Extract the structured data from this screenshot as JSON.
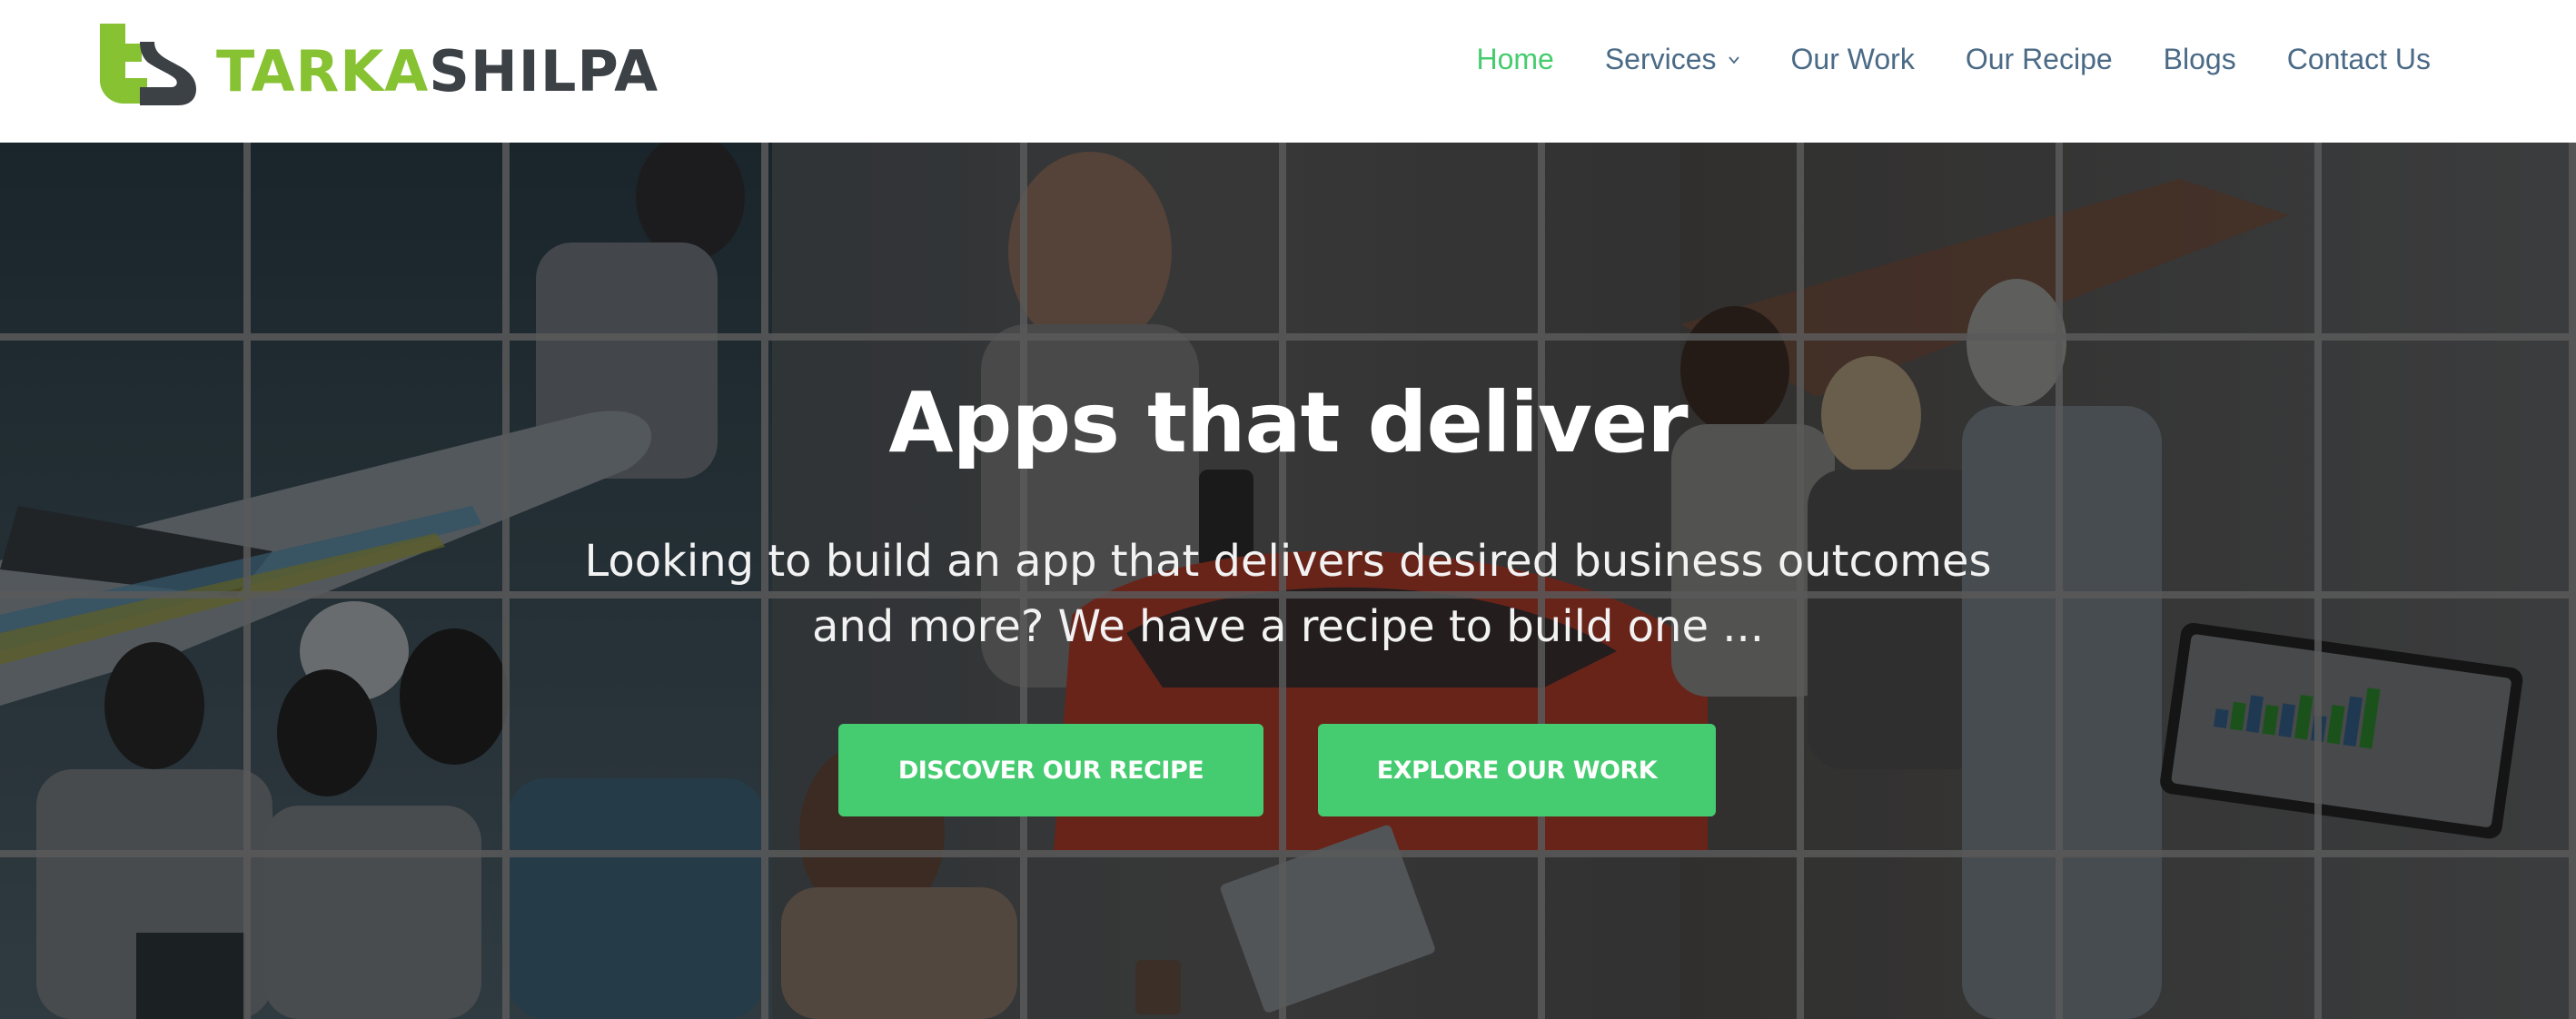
{
  "brand": {
    "logo_part1": "TARKA",
    "logo_part2": "SHILPA",
    "colors": {
      "green": "#86c232",
      "dark": "#3c4146"
    }
  },
  "nav": {
    "items": [
      {
        "label": "Home",
        "active": true
      },
      {
        "label": "Services",
        "has_dropdown": true
      },
      {
        "label": "Our Work"
      },
      {
        "label": "Our Recipe"
      },
      {
        "label": "Blogs"
      },
      {
        "label": "Contact Us"
      }
    ],
    "colors": {
      "active": "#45cc6e",
      "default": "#4a6a86"
    }
  },
  "hero": {
    "title": "Apps that deliver",
    "subtitle_line1": "Looking to build an app that delivers desired business outcomes",
    "subtitle_line2": "and more? We have a recipe to build one ...",
    "buttons": [
      {
        "label": "DISCOVER OUR RECIPE"
      },
      {
        "label": "EXPLORE OUR WORK"
      }
    ],
    "button_color": "#45cc70"
  }
}
